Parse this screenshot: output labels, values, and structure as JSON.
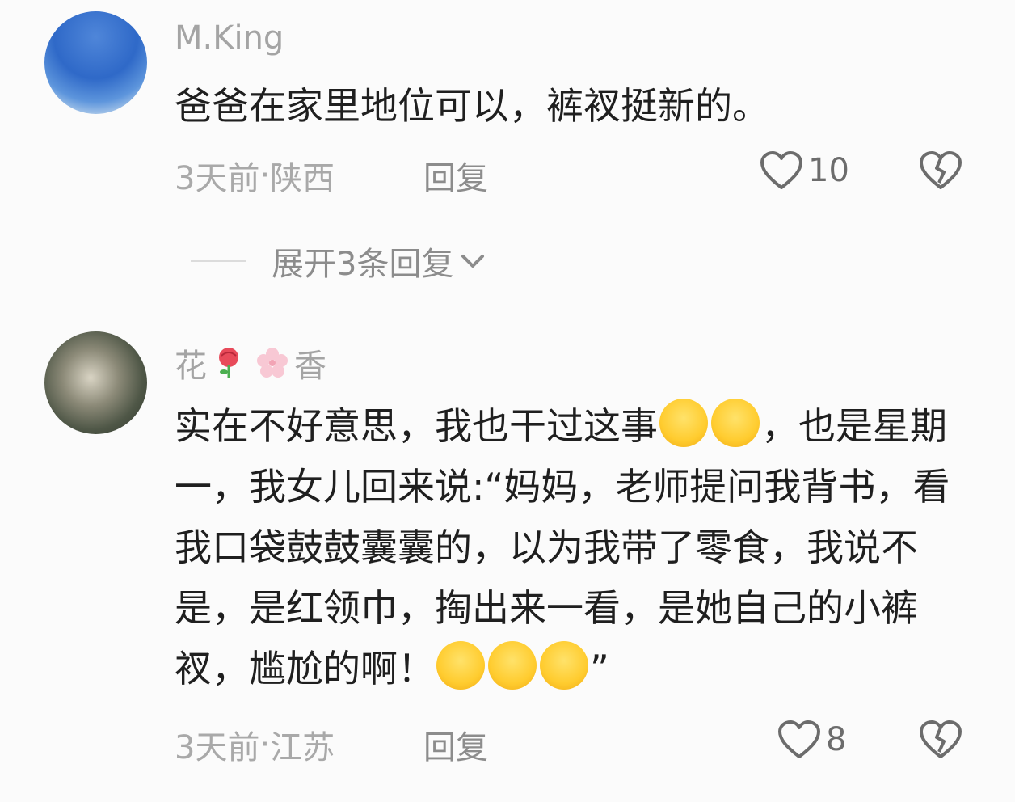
{
  "comments": [
    {
      "username": "M.King",
      "text": "爸爸在家里地位可以，裤衩挺新的。",
      "time": "3天前",
      "separator": " · ",
      "location": "陕西",
      "reply_label": "回复",
      "likes": "10",
      "expand_label": "展开3条回复"
    },
    {
      "username_part1": "花",
      "username_part2": "香",
      "text_part1": "实在不好意思，我也干过这事",
      "text_part2": "，也是星期一，我女儿回来说:“妈妈，老师提问我背书，看我口袋鼓鼓囊囊的，以为我带了零食，我说不是，是红领巾，掏出来一看，是她自己的小裤衩，尴尬的啊！",
      "text_part3": "”",
      "time": "3天前",
      "separator": " · ",
      "location": "江苏",
      "reply_label": "回复",
      "likes": "8"
    }
  ],
  "icons": {
    "like": "heart-outline-icon",
    "dislike": "broken-heart-icon",
    "expand": "chevron-down-icon",
    "emoji_laugh": "rolling-laughing-emoji",
    "emoji_sweat": "downcast-sweat-emoji",
    "emoji_grin_sweat": "grinning-sweat-emoji",
    "rose": "rose-icon",
    "blossom": "cherry-blossom-icon"
  },
  "colors": {
    "text": "#1f1f1f",
    "muted": "#a4a4a4",
    "background": "#fbfbfb"
  }
}
